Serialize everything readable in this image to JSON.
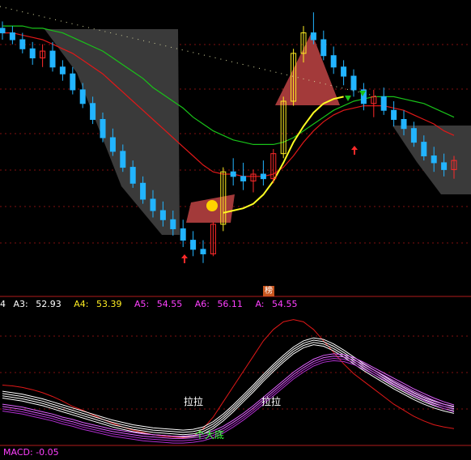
{
  "colors": {
    "up_red": "#ff2a2a",
    "up_yellow": "#ffee22",
    "down_cyan": "#22b4ff",
    "ma_red": "#e01818",
    "ma_green": "#19c219",
    "ma_yellow": "#ffff22",
    "divider": "#b01c1c",
    "magenta": "#ff40ff",
    "white": "#ffffff",
    "green": "#39ff39",
    "dash": "#7f1010",
    "zone_gray": "#3a3a3a",
    "zone_red": "#a33a3a"
  },
  "indicator": {
    "prefix": "4",
    "items": [
      {
        "label": "A3:",
        "value": "52.93",
        "color": "#ffffff"
      },
      {
        "label": "A4:",
        "value": "53.39",
        "color": "#ffee22"
      },
      {
        "label": "A5:",
        "value": "54.55",
        "color": "#ff40ff"
      },
      {
        "label": "A6:",
        "value": "56.11",
        "color": "#ff40ff"
      },
      {
        "label": "A:",
        "value": "54.55",
        "color": "#ff40ff"
      }
    ]
  },
  "macd": {
    "label": "MACD:",
    "value": "-0.05"
  },
  "badge": "榜",
  "annotations": {
    "pull1": "拉拉",
    "pull2": "拉拉",
    "bottom": "个大底"
  },
  "chart_data": {
    "type": "candlestick",
    "candles": [
      [
        41.5,
        41.8,
        41.0,
        41.3
      ],
      [
        41.3,
        41.6,
        40.8,
        41.0
      ],
      [
        41.0,
        41.3,
        40.4,
        40.6
      ],
      [
        40.6,
        40.9,
        39.9,
        40.2
      ],
      [
        40.2,
        40.8,
        39.8,
        40.5
      ],
      [
        40.5,
        40.9,
        39.6,
        39.8
      ],
      [
        39.8,
        40.1,
        39.2,
        39.5
      ],
      [
        39.5,
        39.8,
        38.6,
        38.8
      ],
      [
        38.8,
        39.1,
        38.0,
        38.2
      ],
      [
        38.2,
        38.5,
        37.3,
        37.5
      ],
      [
        37.5,
        37.8,
        36.5,
        36.7
      ],
      [
        36.7,
        37.1,
        35.9,
        36.1
      ],
      [
        36.1,
        36.4,
        35.2,
        35.4
      ],
      [
        35.4,
        35.7,
        34.5,
        34.7
      ],
      [
        34.7,
        35.0,
        33.8,
        34.0
      ],
      [
        34.0,
        34.4,
        33.2,
        33.5
      ],
      [
        33.5,
        33.9,
        32.8,
        33.1
      ],
      [
        33.1,
        33.5,
        32.4,
        32.7
      ],
      [
        32.7,
        33.1,
        31.9,
        32.2
      ],
      [
        32.2,
        32.6,
        31.5,
        31.8
      ],
      [
        31.8,
        32.2,
        31.2,
        31.6
      ],
      [
        31.6,
        33.0,
        31.5,
        32.9
      ],
      [
        32.9,
        35.4,
        32.6,
        35.2
      ],
      [
        35.2,
        35.8,
        34.6,
        35.0
      ],
      [
        35.0,
        35.6,
        34.4,
        34.8
      ],
      [
        34.8,
        35.3,
        34.3,
        35.1
      ],
      [
        35.1,
        35.7,
        34.6,
        34.9
      ],
      [
        34.9,
        36.2,
        34.7,
        36.0
      ],
      [
        36.0,
        38.5,
        35.8,
        38.3
      ],
      [
        38.3,
        40.6,
        38.1,
        40.4
      ],
      [
        40.4,
        41.6,
        40.0,
        41.3
      ],
      [
        41.3,
        42.2,
        40.8,
        41.0
      ],
      [
        41.0,
        41.4,
        40.1,
        40.3
      ],
      [
        40.3,
        40.7,
        39.5,
        39.8
      ],
      [
        39.8,
        40.1,
        39.0,
        39.4
      ],
      [
        39.4,
        39.7,
        38.5,
        38.8
      ],
      [
        38.8,
        39.1,
        37.9,
        38.2
      ],
      [
        38.2,
        38.8,
        37.6,
        38.5
      ],
      [
        38.5,
        38.9,
        37.7,
        37.9
      ],
      [
        37.9,
        38.3,
        37.2,
        37.5
      ],
      [
        37.5,
        37.9,
        36.8,
        37.1
      ],
      [
        37.1,
        37.4,
        36.3,
        36.5
      ],
      [
        36.5,
        36.8,
        35.7,
        35.9
      ],
      [
        35.9,
        36.3,
        35.2,
        35.6
      ],
      [
        35.6,
        36.0,
        35.0,
        35.3
      ],
      [
        35.3,
        35.9,
        34.9,
        35.7
      ]
    ],
    "ma": {
      "red": [
        41.3,
        41.3,
        41.2,
        41.1,
        41.0,
        40.8,
        40.6,
        40.4,
        40.1,
        39.8,
        39.5,
        39.1,
        38.7,
        38.3,
        37.9,
        37.5,
        37.1,
        36.7,
        36.3,
        35.9,
        35.5,
        35.2,
        35.1,
        35.1,
        35.0,
        35.0,
        35.0,
        35.1,
        35.4,
        35.9,
        36.5,
        37.0,
        37.4,
        37.7,
        37.9,
        38.0,
        38.1,
        38.1,
        38.1,
        38.0,
        37.9,
        37.7,
        37.5,
        37.3,
        37.0,
        36.8
      ],
      "green": [
        41.6,
        41.6,
        41.6,
        41.5,
        41.5,
        41.4,
        41.3,
        41.1,
        40.9,
        40.7,
        40.5,
        40.2,
        39.9,
        39.6,
        39.3,
        38.9,
        38.6,
        38.3,
        38.0,
        37.6,
        37.3,
        37.0,
        36.8,
        36.6,
        36.5,
        36.4,
        36.4,
        36.4,
        36.5,
        36.7,
        37.0,
        37.3,
        37.6,
        37.9,
        38.1,
        38.3,
        38.4,
        38.5,
        38.5,
        38.5,
        38.4,
        38.3,
        38.2,
        38.0,
        37.8,
        37.6
      ],
      "yellow": [
        null,
        null,
        null,
        null,
        null,
        null,
        null,
        null,
        null,
        null,
        null,
        null,
        null,
        null,
        null,
        null,
        null,
        null,
        null,
        null,
        null,
        null,
        33.4,
        33.5,
        33.6,
        33.8,
        34.2,
        34.8,
        35.6,
        36.5,
        37.2,
        37.8,
        38.2,
        38.4,
        38.5
      ]
    },
    "oscillator": {
      "red": [
        -3,
        -4,
        -6,
        -9,
        -13,
        -18,
        -24,
        -31,
        -36,
        -42,
        -48,
        -53,
        -58,
        -62,
        -65,
        -68,
        -70,
        -71,
        -72,
        -70,
        -60,
        -45,
        -25,
        -5,
        15,
        35,
        55,
        70,
        80,
        83,
        80,
        70,
        55,
        40,
        25,
        12,
        2,
        -8,
        -18,
        -28,
        -36,
        -44,
        -50,
        -55,
        -58,
        -60
      ],
      "white": [
        -20,
        -22,
        -24,
        -27,
        -30,
        -34,
        -38,
        -42,
        -46,
        -50,
        -54,
        -58,
        -61,
        -64,
        -66,
        -68,
        -69,
        -70,
        -71,
        -70,
        -67,
        -60,
        -50,
        -38,
        -25,
        -12,
        2,
        15,
        27,
        38,
        46,
        50,
        48,
        42,
        34,
        25,
        16,
        8,
        0,
        -8,
        -15,
        -22,
        -28,
        -33,
        -37,
        -40
      ],
      "magenta": [
        -28,
        -30,
        -32,
        -35,
        -38,
        -41,
        -45,
        -48,
        -52,
        -55,
        -58,
        -61,
        -63,
        -65,
        -67,
        -68,
        -69,
        -70,
        -70,
        -69,
        -67,
        -63,
        -57,
        -49,
        -40,
        -30,
        -19,
        -8,
        3,
        14,
        23,
        31,
        36,
        38,
        37,
        33,
        27,
        20,
        13,
        6,
        -1,
        -8,
        -14,
        -20,
        -25,
        -29
      ]
    }
  }
}
